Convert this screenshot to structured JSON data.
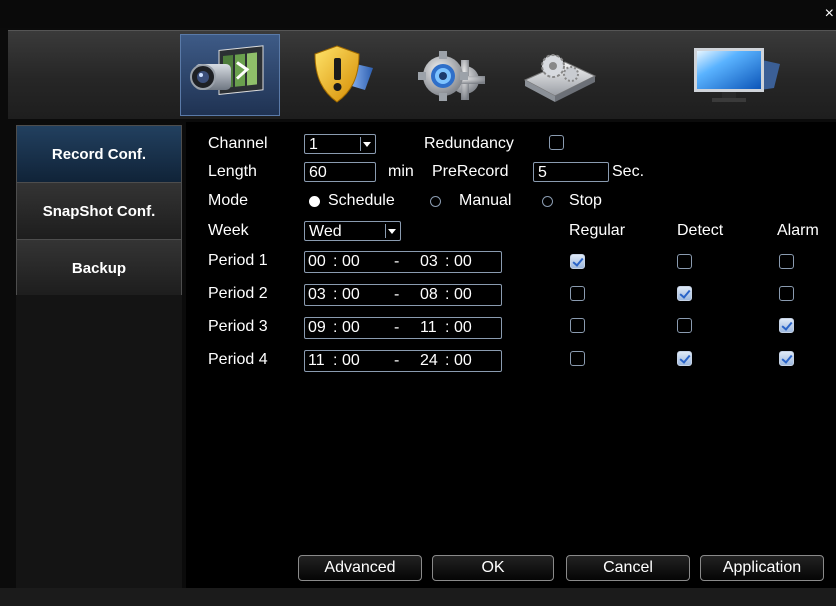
{
  "window": {
    "close_glyph": "×"
  },
  "toolbar": {
    "icons": [
      {
        "name": "record-camera-icon",
        "active": true
      },
      {
        "name": "alarm-shield-icon",
        "active": false
      },
      {
        "name": "system-gear-icon",
        "active": false
      },
      {
        "name": "advanced-settings-icon",
        "active": false
      },
      {
        "name": "info-monitor-icon",
        "active": false
      }
    ]
  },
  "sidebar": {
    "items": [
      {
        "label": "Record Conf.",
        "active": true
      },
      {
        "label": "SnapShot Conf.",
        "active": false
      },
      {
        "label": "Backup",
        "active": false
      }
    ]
  },
  "form": {
    "channel_label": "Channel",
    "channel_value": "1",
    "redundancy_label": "Redundancy",
    "redundancy_checked": false,
    "length_label": "Length",
    "length_value": "60",
    "length_unit": "min",
    "prerecord_label": "PreRecord",
    "prerecord_value": "5",
    "prerecord_unit": "Sec.",
    "mode_label": "Mode",
    "mode_options": [
      "Schedule",
      "Manual",
      "Stop"
    ],
    "mode_selected": "Schedule",
    "week_label": "Week",
    "week_value": "Wed",
    "col_regular": "Regular",
    "col_detect": "Detect",
    "col_alarm": "Alarm"
  },
  "periods": [
    {
      "label": "Period 1",
      "start_h": "00",
      "start_m": "00",
      "end_h": "03",
      "end_m": "00",
      "sep": "-",
      "regular": true,
      "detect": false,
      "alarm": false
    },
    {
      "label": "Period 2",
      "start_h": "03",
      "start_m": "00",
      "end_h": "08",
      "end_m": "00",
      "sep": "-",
      "regular": false,
      "detect": true,
      "alarm": false
    },
    {
      "label": "Period 3",
      "start_h": "09",
      "start_m": "00",
      "end_h": "11",
      "end_m": "00",
      "sep": "-",
      "regular": false,
      "detect": false,
      "alarm": true
    },
    {
      "label": "Period 4",
      "start_h": "11",
      "start_m": "00",
      "end_h": "24",
      "end_m": "00",
      "sep": "-",
      "regular": false,
      "detect": true,
      "alarm": true
    }
  ],
  "buttons": {
    "advanced": "Advanced",
    "ok": "OK",
    "cancel": "Cancel",
    "application": "Application"
  }
}
